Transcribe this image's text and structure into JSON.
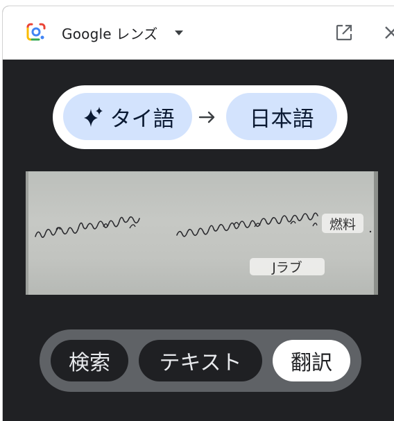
{
  "titlebar": {
    "app_name": "Google レンズ",
    "icons": [
      "google-lens-logo-icon",
      "chevron-down-icon",
      "open-in-new-icon",
      "close-icon"
    ]
  },
  "translate": {
    "source_language": "タイ語",
    "target_language": "日本語",
    "icons": [
      "sparkle-icon",
      "arrow-right-icon"
    ]
  },
  "image": {
    "handwriting_text": "ในโลกที่กำลังลุกไหม้   ขอให้ฉันช่วยซื้อเงินเพิ่มและ",
    "translation_overlays": [
      "燃料",
      "Jラブ"
    ]
  },
  "modes": {
    "search": "検索",
    "text": "テキスト",
    "translate": "翻訳",
    "selected": "翻訳"
  },
  "colors": {
    "background": "#202124",
    "language_chip": "#d3e3fd",
    "mode_bar": "#5f6266",
    "selected_mode": "#ffffff"
  }
}
